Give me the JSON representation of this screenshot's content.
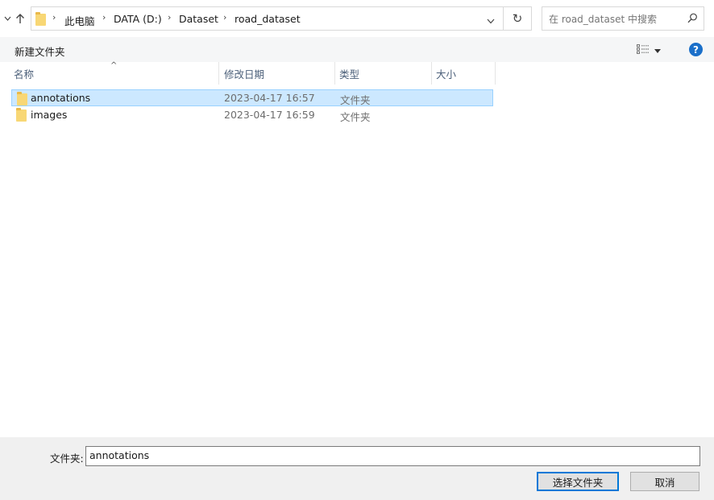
{
  "address_bar": {
    "breadcrumbs": [
      "此电脑",
      "DATA (D:)",
      "Dataset",
      "road_dataset"
    ]
  },
  "search": {
    "placeholder": "在 road_dataset 中搜索"
  },
  "toolbar": {
    "new_folder_label": "新建文件夹",
    "help_label": "?"
  },
  "columns": {
    "name": "名称",
    "date": "修改日期",
    "type": "类型",
    "size": "大小"
  },
  "files": [
    {
      "name": "annotations",
      "modified": "2023-04-17 16:57",
      "type": "文件夹",
      "selected": true
    },
    {
      "name": "images",
      "modified": "2023-04-17 16:59",
      "type": "文件夹",
      "selected": false
    }
  ],
  "bottom": {
    "folder_label": "文件夹:",
    "folder_value": "annotations",
    "select_label": "选择文件夹",
    "cancel_label": "取消"
  },
  "colors": {
    "selection_bg": "#cce8ff",
    "selection_border": "#99d1ff",
    "accent": "#0078d7",
    "folder": "#f8d775"
  }
}
